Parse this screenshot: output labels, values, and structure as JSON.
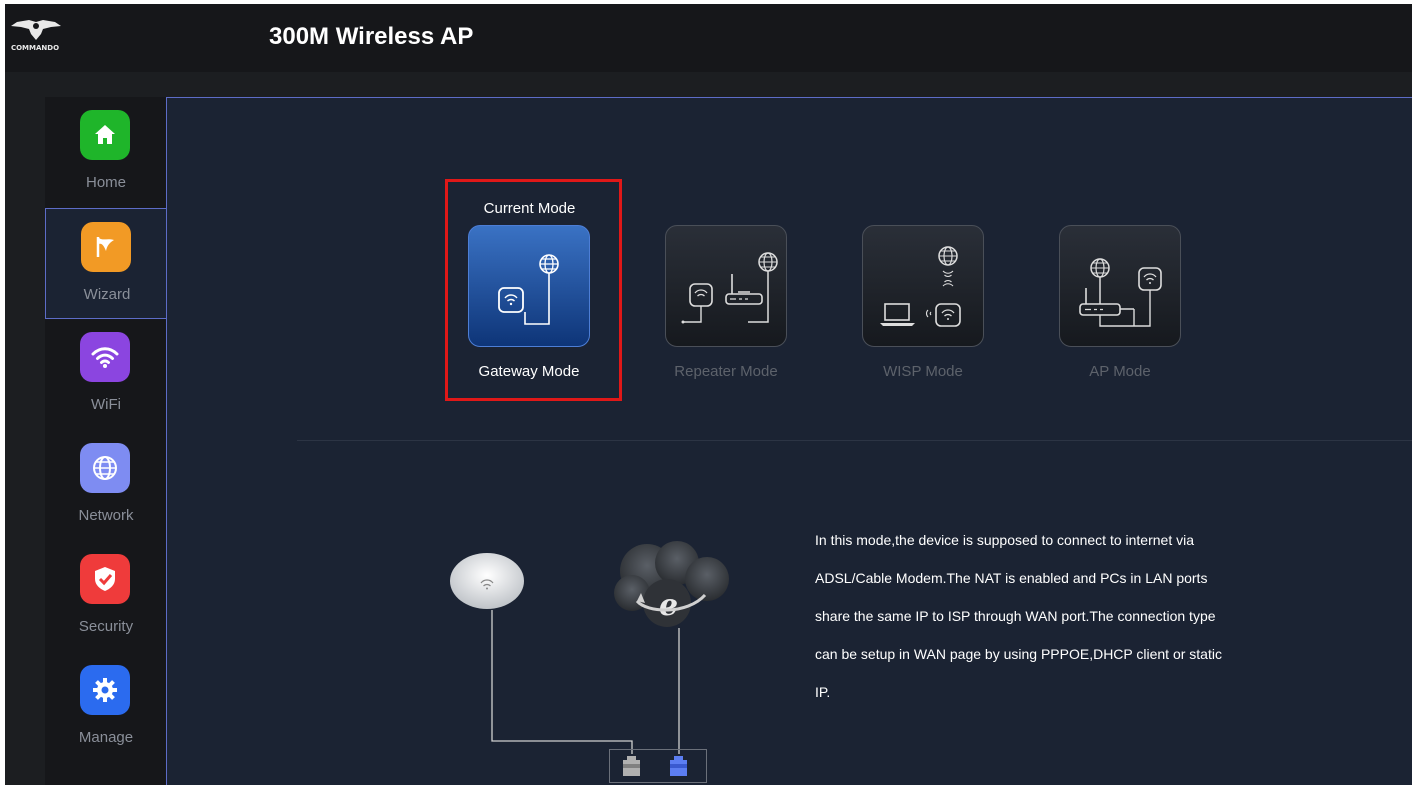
{
  "header": {
    "logo_text": "COMMANDO",
    "title": "300M Wireless AP"
  },
  "sidebar": {
    "items": [
      {
        "label": "Home",
        "icon": "home-icon",
        "color": "#1fb52a"
      },
      {
        "label": "Wizard",
        "icon": "flag-icon",
        "color": "#f29a25",
        "active": true
      },
      {
        "label": "WiFi",
        "icon": "wifi-icon",
        "color": "#8b45e0"
      },
      {
        "label": "Network",
        "icon": "globe-icon",
        "color": "#7e8cf2"
      },
      {
        "label": "Security",
        "icon": "shield-icon",
        "color": "#ef3b3b"
      },
      {
        "label": "Manage",
        "icon": "gear-icon",
        "color": "#2b6bef"
      }
    ]
  },
  "modes": {
    "current_title": "Current Mode",
    "items": [
      {
        "label": "Gateway Mode",
        "selected": true
      },
      {
        "label": "Repeater Mode",
        "selected": false
      },
      {
        "label": "WISP Mode",
        "selected": false
      },
      {
        "label": "AP Mode",
        "selected": false
      }
    ]
  },
  "description": "In this mode,the device is supposed to connect to internet via ADSL/Cable Modem.The NAT is enabled and PCs in LAN ports share the same IP to ISP through WAN port.The connection type can be setup in WAN page by using PPPOE,DHCP client or static IP.",
  "colors": {
    "accent": "#5d6cc7",
    "highlight": "#e01818",
    "selected_card": "#1e56ad"
  }
}
